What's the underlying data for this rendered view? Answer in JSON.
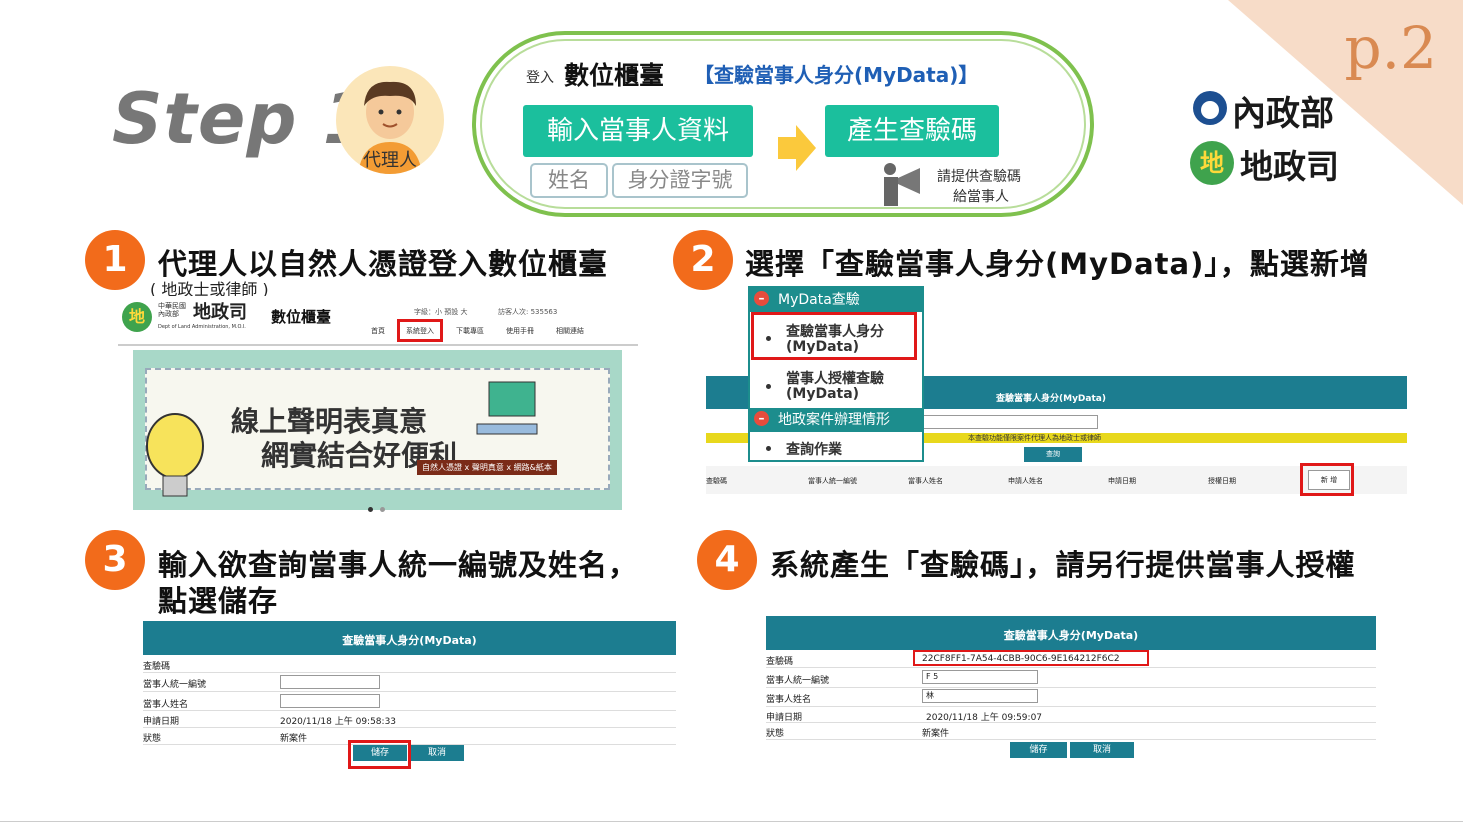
{
  "page_number": "p.2",
  "step_title": "Step 1",
  "avatar_label": "代理人",
  "header": {
    "login_prefix": "登入",
    "counter_name": "數位櫃臺",
    "mydata_label": "【查驗當事人身分(MyData)】",
    "btn_input": "輸入當事人資料",
    "btn_generate": "產生查驗碼",
    "field_name": "姓名",
    "field_id": "身分證字號",
    "provide_line1": "請提供查驗碼",
    "provide_line2": "給當事人"
  },
  "logos": {
    "ministry": "內政部",
    "dept": "地政司",
    "dept_mark": "地"
  },
  "steps": [
    {
      "num": "1",
      "title": "代理人以自然人憑證登入數位櫃臺",
      "sub": "( 地政士或律師 )"
    },
    {
      "num": "2",
      "title": "選擇「查驗當事人身分(MyData)」，點選新增"
    },
    {
      "num": "3",
      "title": "輸入欲查詢當事人統一編號及姓名，",
      "title2": "點選儲存"
    },
    {
      "num": "4",
      "title": "系統產生「查驗碼」，請另行提供當事人授權"
    }
  ],
  "site": {
    "small_org": "中華民國\n內政部",
    "org_name": "地政司",
    "org_en": "Dept of Land Administration, M.O.I.",
    "portal": "數位櫃臺",
    "font_label": "字級：小 預設 大",
    "visitors": "訪客人次: 535563",
    "nav": [
      "首頁",
      "系統登入",
      "下載專區",
      "使用手冊",
      "相關連結"
    ],
    "banner_line1": "線上聲明表真意",
    "banner_line2": "網實結合好便利",
    "banner_tag": "自然人憑證 x 聲明真意 x 網路&紙本"
  },
  "mydata_panel": {
    "menu1": "MyData查驗",
    "item1a": "查驗當事人身分",
    "item1b": "(MyData)",
    "item2a": "當事人授權查驗",
    "item2b": "(MyData)",
    "menu2": "地政案件辦理情形",
    "item3": "查詢作業",
    "table_title": "查驗當事人身分(MyData)",
    "notice": "本查驗功能僅限案件代理人為地政士或律師",
    "search_btn": "查詢",
    "columns": [
      "查驗碼",
      "當事人統一編號",
      "當事人姓名",
      "申請人姓名",
      "申請日期",
      "授權日期"
    ],
    "add_btn": "新 增"
  },
  "form3": {
    "title": "查驗當事人身分(MyData)",
    "labels": [
      "查驗碼",
      "當事人統一編號",
      "當事人姓名",
      "申請日期",
      "狀態"
    ],
    "apply_date": "2020/11/18 上午 09:58:33",
    "status": "新案件",
    "save": "儲存",
    "cancel": "取消"
  },
  "form4": {
    "title": "查驗當事人身分(MyData)",
    "labels": [
      "查驗碼",
      "當事人統一編號",
      "當事人姓名",
      "申請日期",
      "狀態"
    ],
    "code": "22CF8FF1-7A54-4CBB-90C6-9E164212F6C2",
    "id_value": "F                    5",
    "name_value": "林",
    "apply_date": "2020/11/18 上午 09:59:07",
    "status": "新案件",
    "save": "儲存",
    "cancel": "取消"
  }
}
